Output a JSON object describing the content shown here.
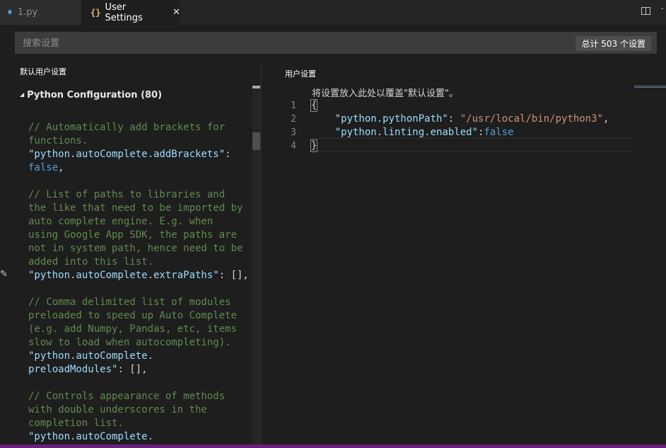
{
  "tabs": [
    {
      "label": "1.py",
      "icon": "python-file-icon"
    },
    {
      "label": "User Settings",
      "icon": "json-braces-icon",
      "close": "✕"
    }
  ],
  "search": {
    "placeholder": "搜索设置",
    "count": "总计 503 个设置"
  },
  "left_pane": {
    "title": "默认用户设置",
    "section": "Python Configuration (80)",
    "content": [
      {
        "c": "cm",
        "t": "// Automatically add brackets for\nfunctions.\n"
      },
      {
        "c": "key",
        "t": "\"python.autoComplete.addBrackets\""
      },
      {
        "c": "punct",
        "t": ":\n"
      },
      {
        "c": "kw",
        "t": "false"
      },
      {
        "c": "punct",
        "t": ",\n\n"
      },
      {
        "c": "cm",
        "t": "// List of paths to libraries and\nthe like that need to be imported by\nauto complete engine. E.g. when\nusing Google App SDK, the paths are\nnot in system path, hence need to be\nadded into this list.\n"
      },
      {
        "c": "key",
        "t": "\"python.autoComplete.extraPaths\""
      },
      {
        "c": "punct",
        "t": ": [],\n\n"
      },
      {
        "c": "cm",
        "t": "// Comma delimited list of modules\npreloaded to speed up Auto Complete\n(e.g. add Numpy, Pandas, etc, items\nslow to load when autocompleting).\n"
      },
      {
        "c": "key",
        "t": "\"python.autoComplete.\npreloadModules\""
      },
      {
        "c": "punct",
        "t": ": [],\n\n"
      },
      {
        "c": "cm",
        "t": "// Controls appearance of methods\nwith double underscores in the\ncompletion list.\n"
      },
      {
        "c": "key",
        "t": "\"python.autoComplete."
      }
    ]
  },
  "right_pane": {
    "title": "用户设置",
    "hint": "将设置放入此处以覆盖\"默认设置\"。",
    "line_numbers": [
      "1",
      "2",
      "3",
      "4"
    ],
    "lines": [
      [
        {
          "c": "punct",
          "t": "{",
          "box": true
        }
      ],
      [
        {
          "c": "punct",
          "t": "    "
        },
        {
          "c": "key",
          "t": "\"python.pythonPath\""
        },
        {
          "c": "punct",
          "t": ": "
        },
        {
          "c": "str",
          "t": "\"/usr/local/bin/python3\""
        },
        {
          "c": "punct",
          "t": ","
        }
      ],
      [
        {
          "c": "punct",
          "t": "    "
        },
        {
          "c": "key",
          "t": "\"python.linting.enabled\""
        },
        {
          "c": "punct",
          "t": ":"
        },
        {
          "c": "kw",
          "t": "false"
        }
      ],
      [
        {
          "c": "punct",
          "t": "}",
          "box": true
        }
      ]
    ]
  },
  "colors": {
    "accent_status": "#68217a",
    "comment": "#608b4e",
    "key": "#9cdcfe",
    "keyword": "#569cd6",
    "string": "#ce9178"
  }
}
